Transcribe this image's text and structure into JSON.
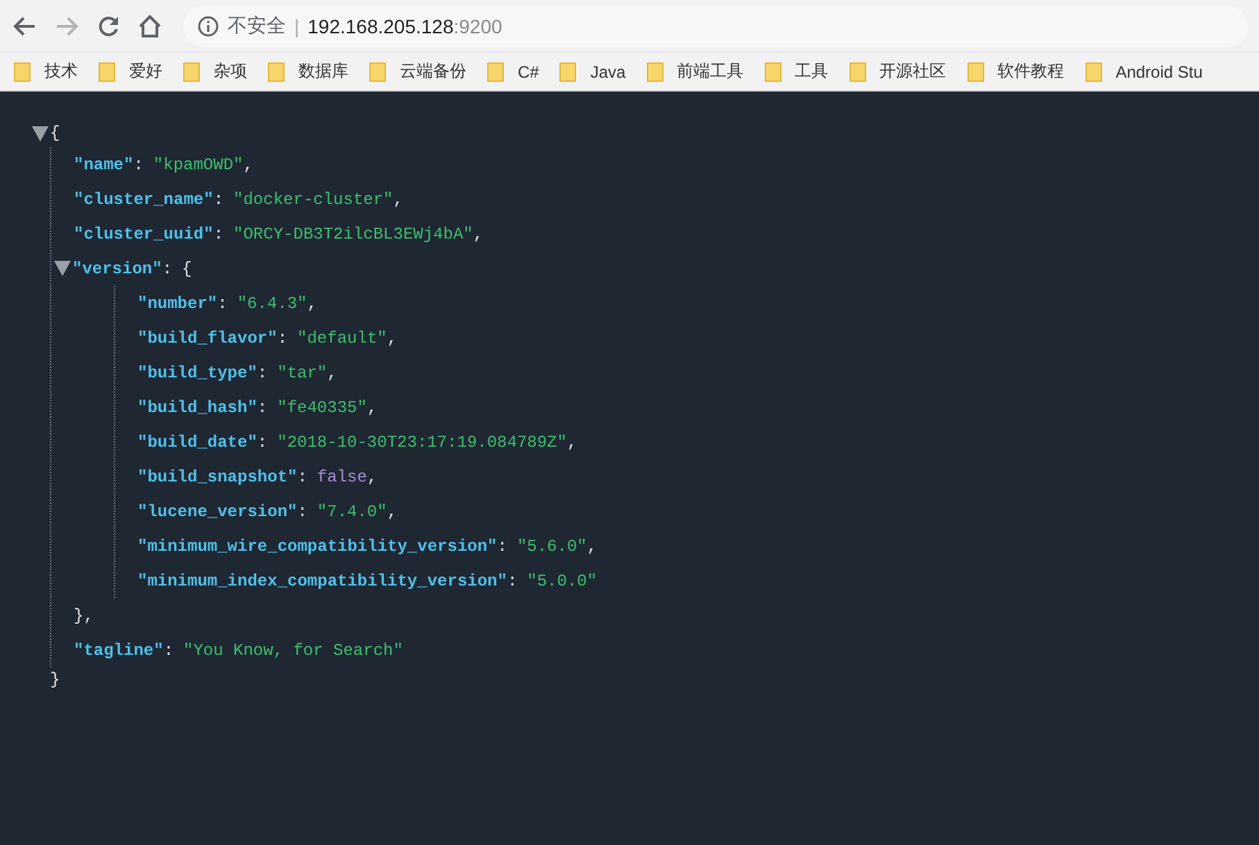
{
  "toolbar": {
    "back": {
      "disabled": false
    },
    "forward": {
      "disabled": true
    },
    "address": {
      "security_label": "不安全",
      "separator": "|",
      "host": "192.168.205.128",
      "port": ":9200"
    }
  },
  "bookmarks": [
    {
      "label": "技术"
    },
    {
      "label": "爱好"
    },
    {
      "label": "杂项"
    },
    {
      "label": "数据库"
    },
    {
      "label": "云端备份"
    },
    {
      "label": "C#"
    },
    {
      "label": "Java"
    },
    {
      "label": "前端工具"
    },
    {
      "label": "工具"
    },
    {
      "label": "开源社区"
    },
    {
      "label": "软件教程"
    },
    {
      "label": "Android Stu"
    }
  ],
  "json_tree": {
    "open": "{",
    "expanded": true,
    "close": "}",
    "children": [
      {
        "kind": "string",
        "key": "\"name\"",
        "colon": ":",
        "value": "\"kpamOWD\"",
        "comma": ","
      },
      {
        "kind": "string",
        "key": "\"cluster_name\"",
        "colon": ":",
        "value": "\"docker-cluster\"",
        "comma": ","
      },
      {
        "kind": "string",
        "key": "\"cluster_uuid\"",
        "colon": ":",
        "value": "\"ORCY-DB3T2ilcBL3EWj4bA\"",
        "comma": ","
      },
      {
        "kind": "object",
        "key": "\"version\"",
        "colon": ":",
        "open": "{",
        "expanded": true,
        "close": "}",
        "comma": ",",
        "children": [
          {
            "kind": "string",
            "key": "\"number\"",
            "colon": ":",
            "value": "\"6.4.3\"",
            "comma": ","
          },
          {
            "kind": "string",
            "key": "\"build_flavor\"",
            "colon": ":",
            "value": "\"default\"",
            "comma": ","
          },
          {
            "kind": "string",
            "key": "\"build_type\"",
            "colon": ":",
            "value": "\"tar\"",
            "comma": ","
          },
          {
            "kind": "string",
            "key": "\"build_hash\"",
            "colon": ":",
            "value": "\"fe40335\"",
            "comma": ","
          },
          {
            "kind": "string",
            "key": "\"build_date\"",
            "colon": ":",
            "value": "\"2018-10-30T23:17:19.084789Z\"",
            "comma": ","
          },
          {
            "kind": "boolean",
            "key": "\"build_snapshot\"",
            "colon": ":",
            "value": "false",
            "comma": ","
          },
          {
            "kind": "string",
            "key": "\"lucene_version\"",
            "colon": ":",
            "value": "\"7.4.0\"",
            "comma": ","
          },
          {
            "kind": "string",
            "key": "\"minimum_wire_compatibility_version\"",
            "colon": ":",
            "value": "\"5.6.0\"",
            "comma": ","
          },
          {
            "kind": "string",
            "key": "\"minimum_index_compatibility_version\"",
            "colon": ":",
            "value": "\"5.0.0\""
          }
        ]
      },
      {
        "kind": "string",
        "key": "\"tagline\"",
        "colon": ":",
        "value": "\"You Know, for Search\""
      }
    ]
  }
}
